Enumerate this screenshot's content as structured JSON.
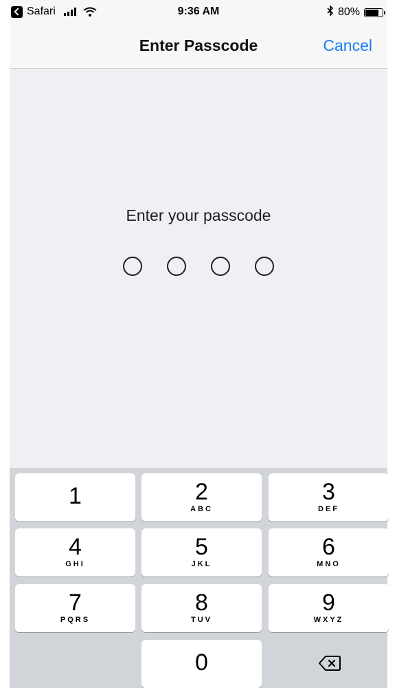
{
  "status_bar": {
    "app": "Safari",
    "time": "9:36 AM",
    "battery": "80%",
    "battery_level": 0.8
  },
  "nav": {
    "title": "Enter Passcode",
    "cancel_label": "Cancel"
  },
  "prompt": "Enter your passcode",
  "passcode_digits_entered": 0,
  "keys": [
    {
      "digit": "1",
      "letters": ""
    },
    {
      "digit": "2",
      "letters": "ABC"
    },
    {
      "digit": "3",
      "letters": "DEF"
    },
    {
      "digit": "4",
      "letters": "GHI"
    },
    {
      "digit": "5",
      "letters": "JKL"
    },
    {
      "digit": "6",
      "letters": "MNO"
    },
    {
      "digit": "7",
      "letters": "PQRS"
    },
    {
      "digit": "8",
      "letters": "TUV"
    },
    {
      "digit": "9",
      "letters": "WXYZ"
    },
    {
      "digit": "0",
      "letters": ""
    }
  ],
  "colors": {
    "accent": "#1a7cf0",
    "background": "#efeff4",
    "keypad_background": "#d1d4d9"
  },
  "icons": {
    "delete": "backspace-icon"
  }
}
